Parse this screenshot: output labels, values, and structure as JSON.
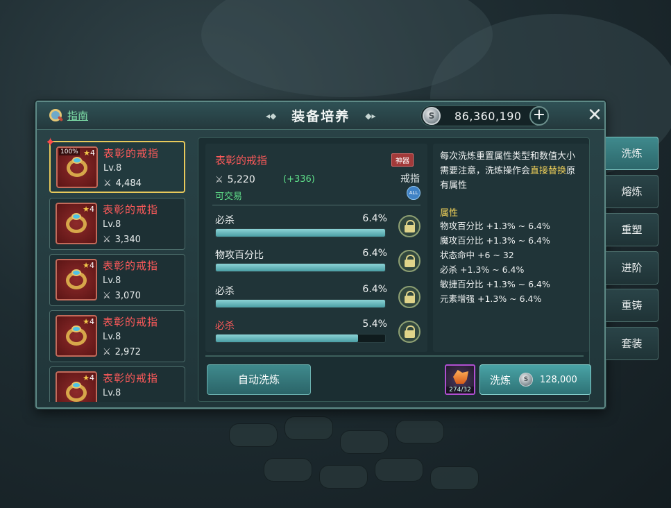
{
  "window": {
    "title": "装备培养",
    "guide_label": "指南",
    "currency_value": "86,360,190",
    "add_symbol": "+",
    "close_symbol": "✕"
  },
  "items": [
    {
      "name": "表彰的戒指",
      "level": "Lv.8",
      "power": "4,484",
      "stars": "4",
      "badge": "100%",
      "selected": true
    },
    {
      "name": "表彰的戒指",
      "level": "Lv.8",
      "power": "3,340",
      "stars": "4"
    },
    {
      "name": "表彰的戒指",
      "level": "Lv.8",
      "power": "3,070",
      "stars": "4"
    },
    {
      "name": "表彰的戒指",
      "level": "Lv.8",
      "power": "2,972",
      "stars": "4"
    },
    {
      "name": "表彰的戒指",
      "level": "Lv.8",
      "power": "",
      "stars": "4"
    }
  ],
  "equipment": {
    "name": "表彰的戒指",
    "tag": "神器",
    "power": "5,220",
    "power_bonus": "(+336)",
    "slot": "戒指",
    "all_badge": "ALL",
    "tradable": "可交易"
  },
  "stats": [
    {
      "name": "必杀",
      "value": "6.4%",
      "fill": 1.0,
      "color": "#eef1f1"
    },
    {
      "name": "物攻百分比",
      "value": "6.4%",
      "fill": 1.0,
      "color": "#eef1f1"
    },
    {
      "name": "必杀",
      "value": "6.4%",
      "fill": 1.0,
      "color": "#eef1f1"
    },
    {
      "name": "必杀",
      "value": "5.4%",
      "fill": 0.84,
      "color": "#ff5a5a"
    }
  ],
  "description": {
    "text_part1": "每次洗炼重置属性类型和数值大小需要注意，洗炼操作会",
    "text_highlight": "直接替换",
    "text_part2": "原有属性",
    "attr_title": "属性",
    "attrs": [
      "物攻百分比 +1.3% ~ 6.4%",
      "魔攻百分比 +1.3% ~ 6.4%",
      "状态命中 +6 ~ 32",
      "必杀 +1.3% ~ 6.4%",
      "敏捷百分比 +1.3% ~ 6.4%",
      "元素增强 +1.3% ~ 6.4%"
    ]
  },
  "actions": {
    "auto_refine": "自动洗炼",
    "material_count": "274/32",
    "refine_label": "洗炼",
    "refine_cost": "128,000"
  },
  "tabs": [
    {
      "label": "洗炼",
      "active": true
    },
    {
      "label": "熔炼"
    },
    {
      "label": "重塑"
    },
    {
      "label": "进阶"
    },
    {
      "label": "重铸"
    },
    {
      "label": "套装"
    }
  ],
  "colors": {
    "accent_teal": "#49a3a6",
    "item_name_red": "#ff5a5a",
    "positive_green": "#5fe08a",
    "highlight_yellow": "#f3d35a",
    "selected_border": "#e8c95b"
  }
}
